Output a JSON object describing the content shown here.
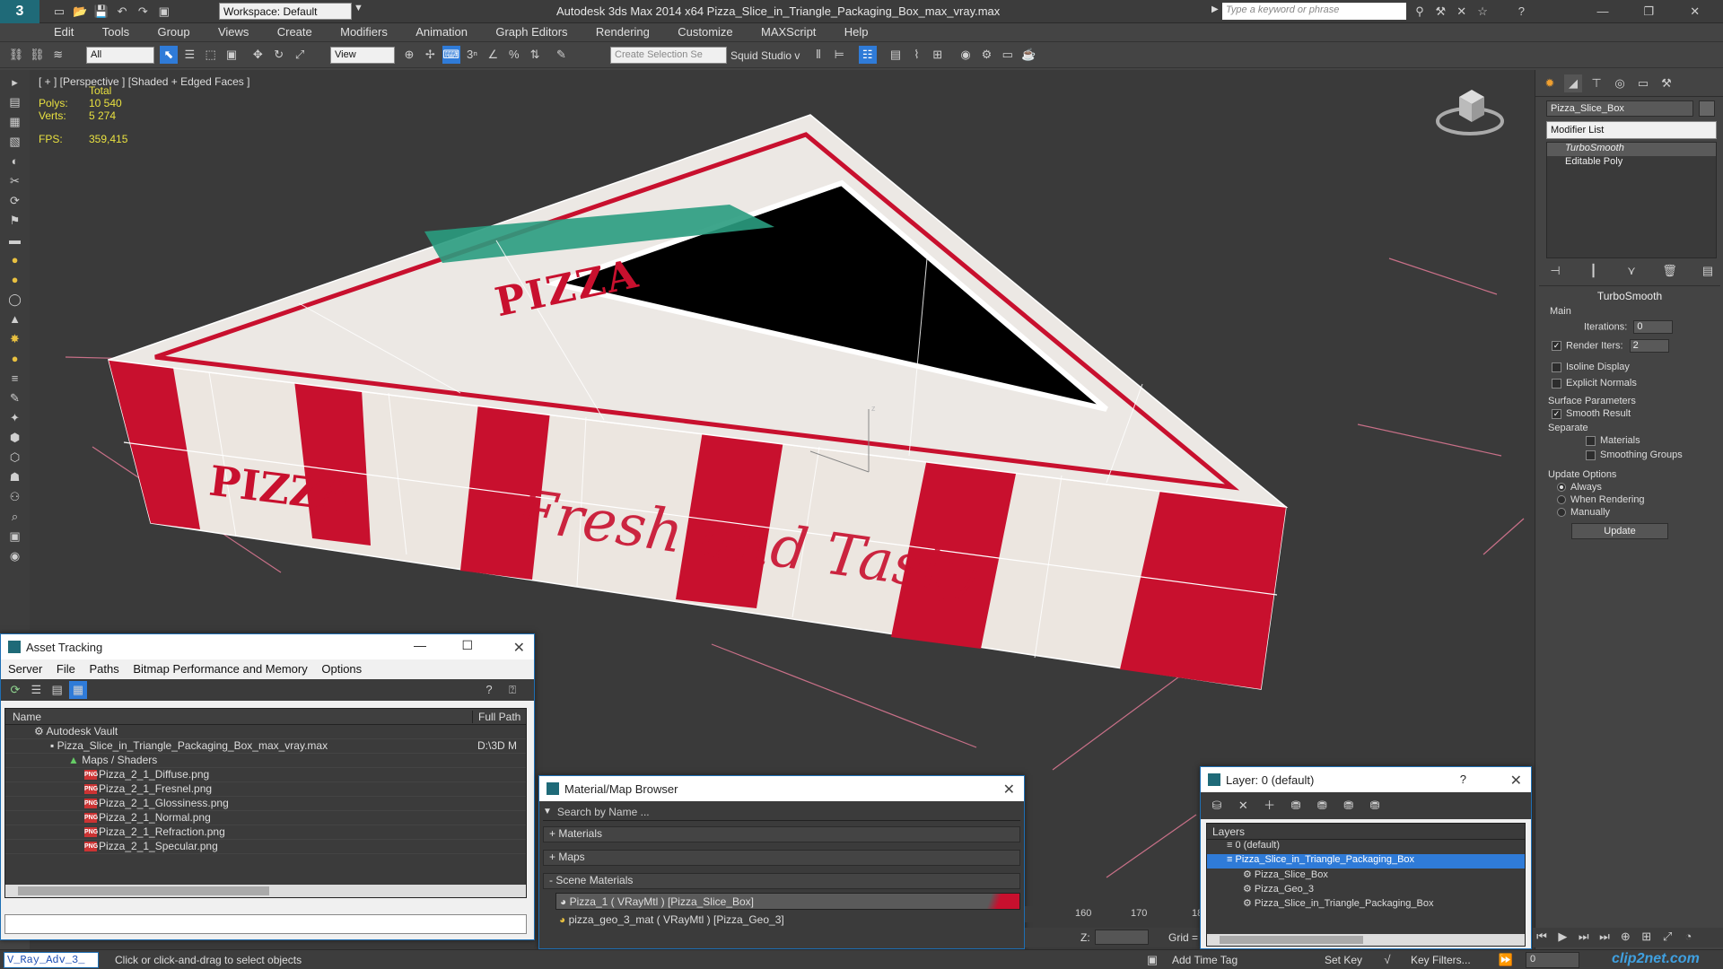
{
  "title_bar": {
    "app_logo": "3",
    "workspace": "Workspace: Default",
    "window_title": "Autodesk 3ds Max  2014 x64     Pizza_Slice_in_Triangle_Packaging_Box_max_vray.max",
    "search_placeholder": "Type a keyword or phrase"
  },
  "menu": [
    "Edit",
    "Tools",
    "Group",
    "Views",
    "Create",
    "Modifiers",
    "Animation",
    "Graph Editors",
    "Rendering",
    "Customize",
    "MAXScript",
    "Help"
  ],
  "toolbar": {
    "selection_filter": "All",
    "ref_coord": "View",
    "selection_set": "Create Selection Se",
    "squid_label": "Squid Studio v"
  },
  "viewport": {
    "label": "[ + ] [Perspective ] [Shaded + Edged Faces ]",
    "stats_total": "Total",
    "polys_label": "Polys:",
    "polys_value": "10 540",
    "verts_label": "Verts:",
    "verts_value": "5 274",
    "fps_label": "FPS:",
    "fps_value": "359,415",
    "box_top_text": "PIZZA",
    "box_side_text": "PIZZA",
    "box_script_text": "Fresh and Tasty",
    "axis_z": "z"
  },
  "command_panel": {
    "object_name": "Pizza_Slice_Box",
    "modifier_list": "Modifier List",
    "stack": [
      "TurboSmooth",
      "Editable Poly"
    ],
    "rollout_title": "TurboSmooth",
    "main_label": "Main",
    "iterations_label": "Iterations:",
    "iterations_value": "0",
    "render_iters_label": "Render Iters:",
    "render_iters_value": "2",
    "isoline_label": "Isoline Display",
    "explicit_normals_label": "Explicit Normals",
    "surface_params_label": "Surface Parameters",
    "smooth_result_label": "Smooth Result",
    "separate_label": "Separate",
    "materials_label": "Materials",
    "smoothing_groups_label": "Smoothing Groups",
    "update_options_label": "Update Options",
    "always_label": "Always",
    "when_rendering_label": "When Rendering",
    "manually_label": "Manually",
    "update_button": "Update"
  },
  "asset_tracking": {
    "title": "Asset Tracking",
    "menu": [
      "Server",
      "File",
      "Paths",
      "Bitmap Performance and Memory",
      "Options"
    ],
    "col_name": "Name",
    "col_path": "Full Path",
    "rows": [
      {
        "label": "Autodesk Vault",
        "path": ""
      },
      {
        "label": "Pizza_Slice_in_Triangle_Packaging_Box_max_vray.max",
        "path": "D:\\3D M"
      },
      {
        "label": "Maps / Shaders",
        "path": ""
      },
      {
        "label": "Pizza_2_1_Diffuse.png",
        "path": ""
      },
      {
        "label": "Pizza_2_1_Fresnel.png",
        "path": ""
      },
      {
        "label": "Pizza_2_1_Glossiness.png",
        "path": ""
      },
      {
        "label": "Pizza_2_1_Normal.png",
        "path": ""
      },
      {
        "label": "Pizza_2_1_Refraction.png",
        "path": ""
      },
      {
        "label": "Pizza_2_1_Specular.png",
        "path": ""
      }
    ]
  },
  "material_browser": {
    "title": "Material/Map Browser",
    "search_placeholder": "Search by Name ...",
    "sections": [
      "+ Materials",
      "+ Maps",
      "- Scene Materials"
    ],
    "items": [
      "Pizza_1  ( VRayMtl ) [Pizza_Slice_Box]",
      "pizza_geo_3_mat  ( VRayMtl ) [Pizza_Geo_3]"
    ]
  },
  "layer_window": {
    "title": "Layer: 0 (default)",
    "help": "?",
    "header": "Layers",
    "rows": [
      "0 (default)",
      "Pizza_Slice_in_Triangle_Packaging_Box",
      "Pizza_Slice_Box",
      "Pizza_Geo_3",
      "Pizza_Slice_in_Triangle_Packaging_Box"
    ]
  },
  "timeline": {
    "tick_160": "160",
    "tick_170": "170",
    "tick_180": "18",
    "z_label": "Z:",
    "grid_label": "Grid ="
  },
  "status_bar": {
    "script_listener": "V_Ray_Adv_3_",
    "prompt": "Click or click-and-drag to select objects",
    "add_time_tag": "Add Time Tag",
    "set_key": "Set Key",
    "key_filters": "Key Filters...",
    "frame_value": "0",
    "watermark": "clip2net.com"
  },
  "colors": {
    "accent_blue": "#1e6fb4",
    "selection_blue": "#2f7bd8",
    "box_red": "#c8102e",
    "stats_yellow": "#e8e040"
  }
}
